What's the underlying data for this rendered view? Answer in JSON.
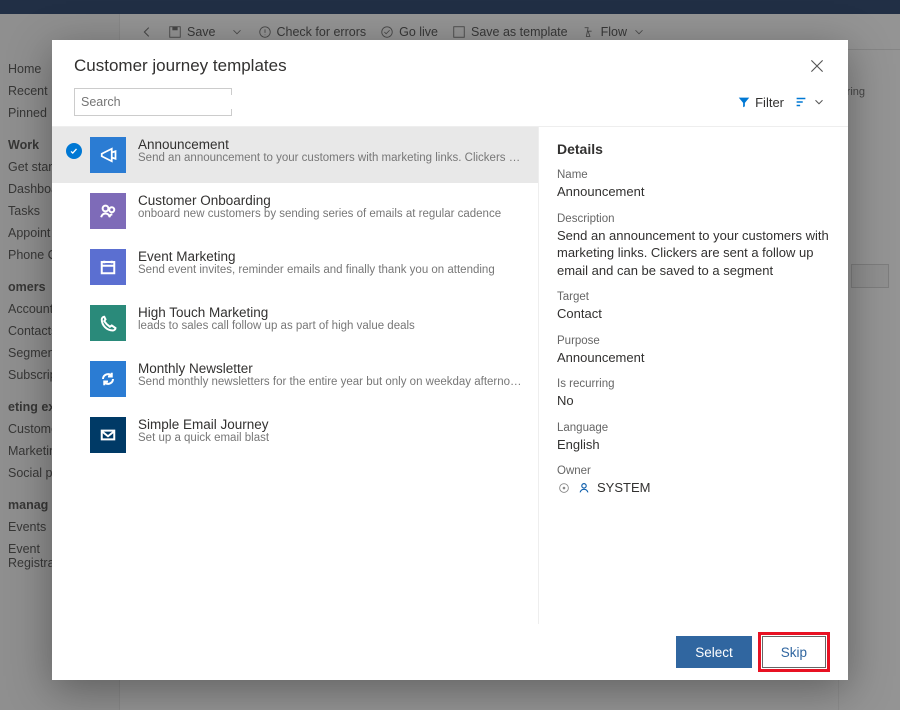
{
  "bg_commands": {
    "save": "Save",
    "check": "Check for errors",
    "golive": "Go live",
    "saveas": "Save as template",
    "flow": "Flow"
  },
  "bg_nav": {
    "home": "Home",
    "recent": "Recent",
    "pinned": "Pinned",
    "work_hdr": "Work",
    "get_started": "Get start",
    "dashboards": "Dashboa",
    "tasks": "Tasks",
    "appoint": "Appoint",
    "phone": "Phone C",
    "cust_hdr": "omers",
    "accounts": "Account",
    "contacts": "Contacts",
    "segments": "Segmen",
    "subscr": "Subscrip",
    "mkt_hdr": "eting ex",
    "custome": "Custome",
    "marketin": "Marketin",
    "social": "Social po",
    "manage_hdr": "manag",
    "events": "Events",
    "eventreg": "Event Registrations"
  },
  "bg_right_label": "rring",
  "modal": {
    "title": "Customer journey templates",
    "search_placeholder": "Search",
    "filter_label": "Filter",
    "select_btn": "Select",
    "skip_btn": "Skip"
  },
  "templates": [
    {
      "title": "Announcement",
      "desc": "Send an announcement to your customers with marketing links. Clickers are sent a...",
      "color": "#2b7cd3",
      "icon": "megaphone",
      "selected": true
    },
    {
      "title": "Customer Onboarding",
      "desc": "onboard new customers by sending series of emails at regular cadence",
      "color": "#7e6bb8",
      "icon": "people"
    },
    {
      "title": "Event Marketing",
      "desc": "Send event invites, reminder emails and finally thank you on attending",
      "color": "#5b6fd1",
      "icon": "calendar"
    },
    {
      "title": "High Touch Marketing",
      "desc": "leads to sales call follow up as part of high value deals",
      "color": "#2a8a7a",
      "icon": "phone"
    },
    {
      "title": "Monthly Newsletter",
      "desc": "Send monthly newsletters for the entire year but only on weekday afternoons",
      "color": "#2b7cd3",
      "icon": "refresh"
    },
    {
      "title": "Simple Email Journey",
      "desc": "Set up a quick email blast",
      "color": "#003a66",
      "icon": "mail"
    }
  ],
  "details": {
    "heading": "Details",
    "name_lbl": "Name",
    "name_val": "Announcement",
    "desc_lbl": "Description",
    "desc_val": "Send an announcement to your customers with marketing links. Clickers are sent a follow up email and can be saved to a segment",
    "target_lbl": "Target",
    "target_val": "Contact",
    "purpose_lbl": "Purpose",
    "purpose_val": "Announcement",
    "recur_lbl": "Is recurring",
    "recur_val": "No",
    "lang_lbl": "Language",
    "lang_val": "English",
    "owner_lbl": "Owner",
    "owner_val": "SYSTEM"
  }
}
